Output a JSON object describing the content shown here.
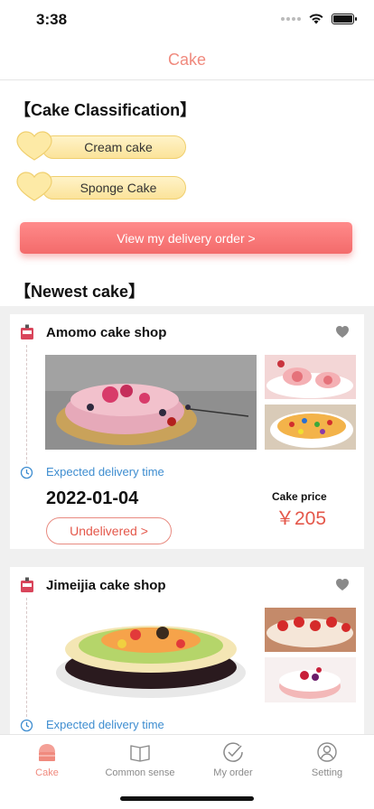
{
  "status_bar": {
    "time": "3:38"
  },
  "nav": {
    "title": "Cake"
  },
  "classification": {
    "title": "【Cake Classification】",
    "items": [
      {
        "label": "Cream cake"
      },
      {
        "label": "Sponge Cake"
      }
    ]
  },
  "delivery_button": {
    "label": "View my delivery order >"
  },
  "newest": {
    "title": "【Newest cake】"
  },
  "orders": [
    {
      "shop": "Amomo cake shop",
      "expected_label": "Expected delivery time",
      "date": "2022-01-04",
      "price_label": "Cake price",
      "price": "￥205",
      "status": "Undelivered >"
    },
    {
      "shop": "Jimeijia cake shop",
      "expected_label": "Expected delivery time"
    }
  ],
  "tabs": [
    {
      "label": "Cake",
      "icon": "cake-icon",
      "active": true
    },
    {
      "label": "Common sense",
      "icon": "book-icon",
      "active": false
    },
    {
      "label": "My order",
      "icon": "check-circle-icon",
      "active": false
    },
    {
      "label": "Setting",
      "icon": "user-circle-icon",
      "active": false
    }
  ],
  "colors": {
    "accent": "#f08a7e",
    "price": "#e4574a",
    "link": "#3e8dd0",
    "button": "#f36b6b"
  }
}
